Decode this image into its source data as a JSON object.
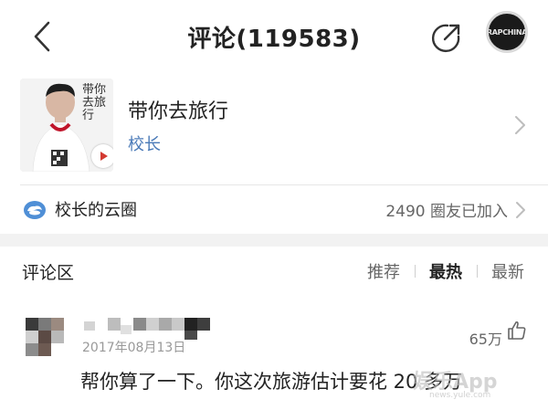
{
  "header": {
    "title": "评论(119583)",
    "avatar_text": "RAPCHINA"
  },
  "song": {
    "title": "带你去旅行",
    "artist": "校长",
    "cover_text": "带你去旅行"
  },
  "circle": {
    "label": "校长的云圈",
    "count": "2490 圈友已加入"
  },
  "comments_section": {
    "title": "评论区",
    "sort_tabs": [
      {
        "label": "推荐",
        "active": false
      },
      {
        "label": "最热",
        "active": true
      },
      {
        "label": "最新",
        "active": false
      }
    ]
  },
  "comment": {
    "date": "2017年08月13日",
    "likes": "65万",
    "text": "帮你算了一下。你这次旅游估计要花 20 多万"
  },
  "watermark": {
    "text": "娱乐App",
    "sub": "news.yule.com"
  },
  "colors": {
    "artist_link": "#4a7ab8",
    "active_tab": "#222222",
    "inactive_tab": "#666666",
    "band": "#f2f2f2"
  }
}
